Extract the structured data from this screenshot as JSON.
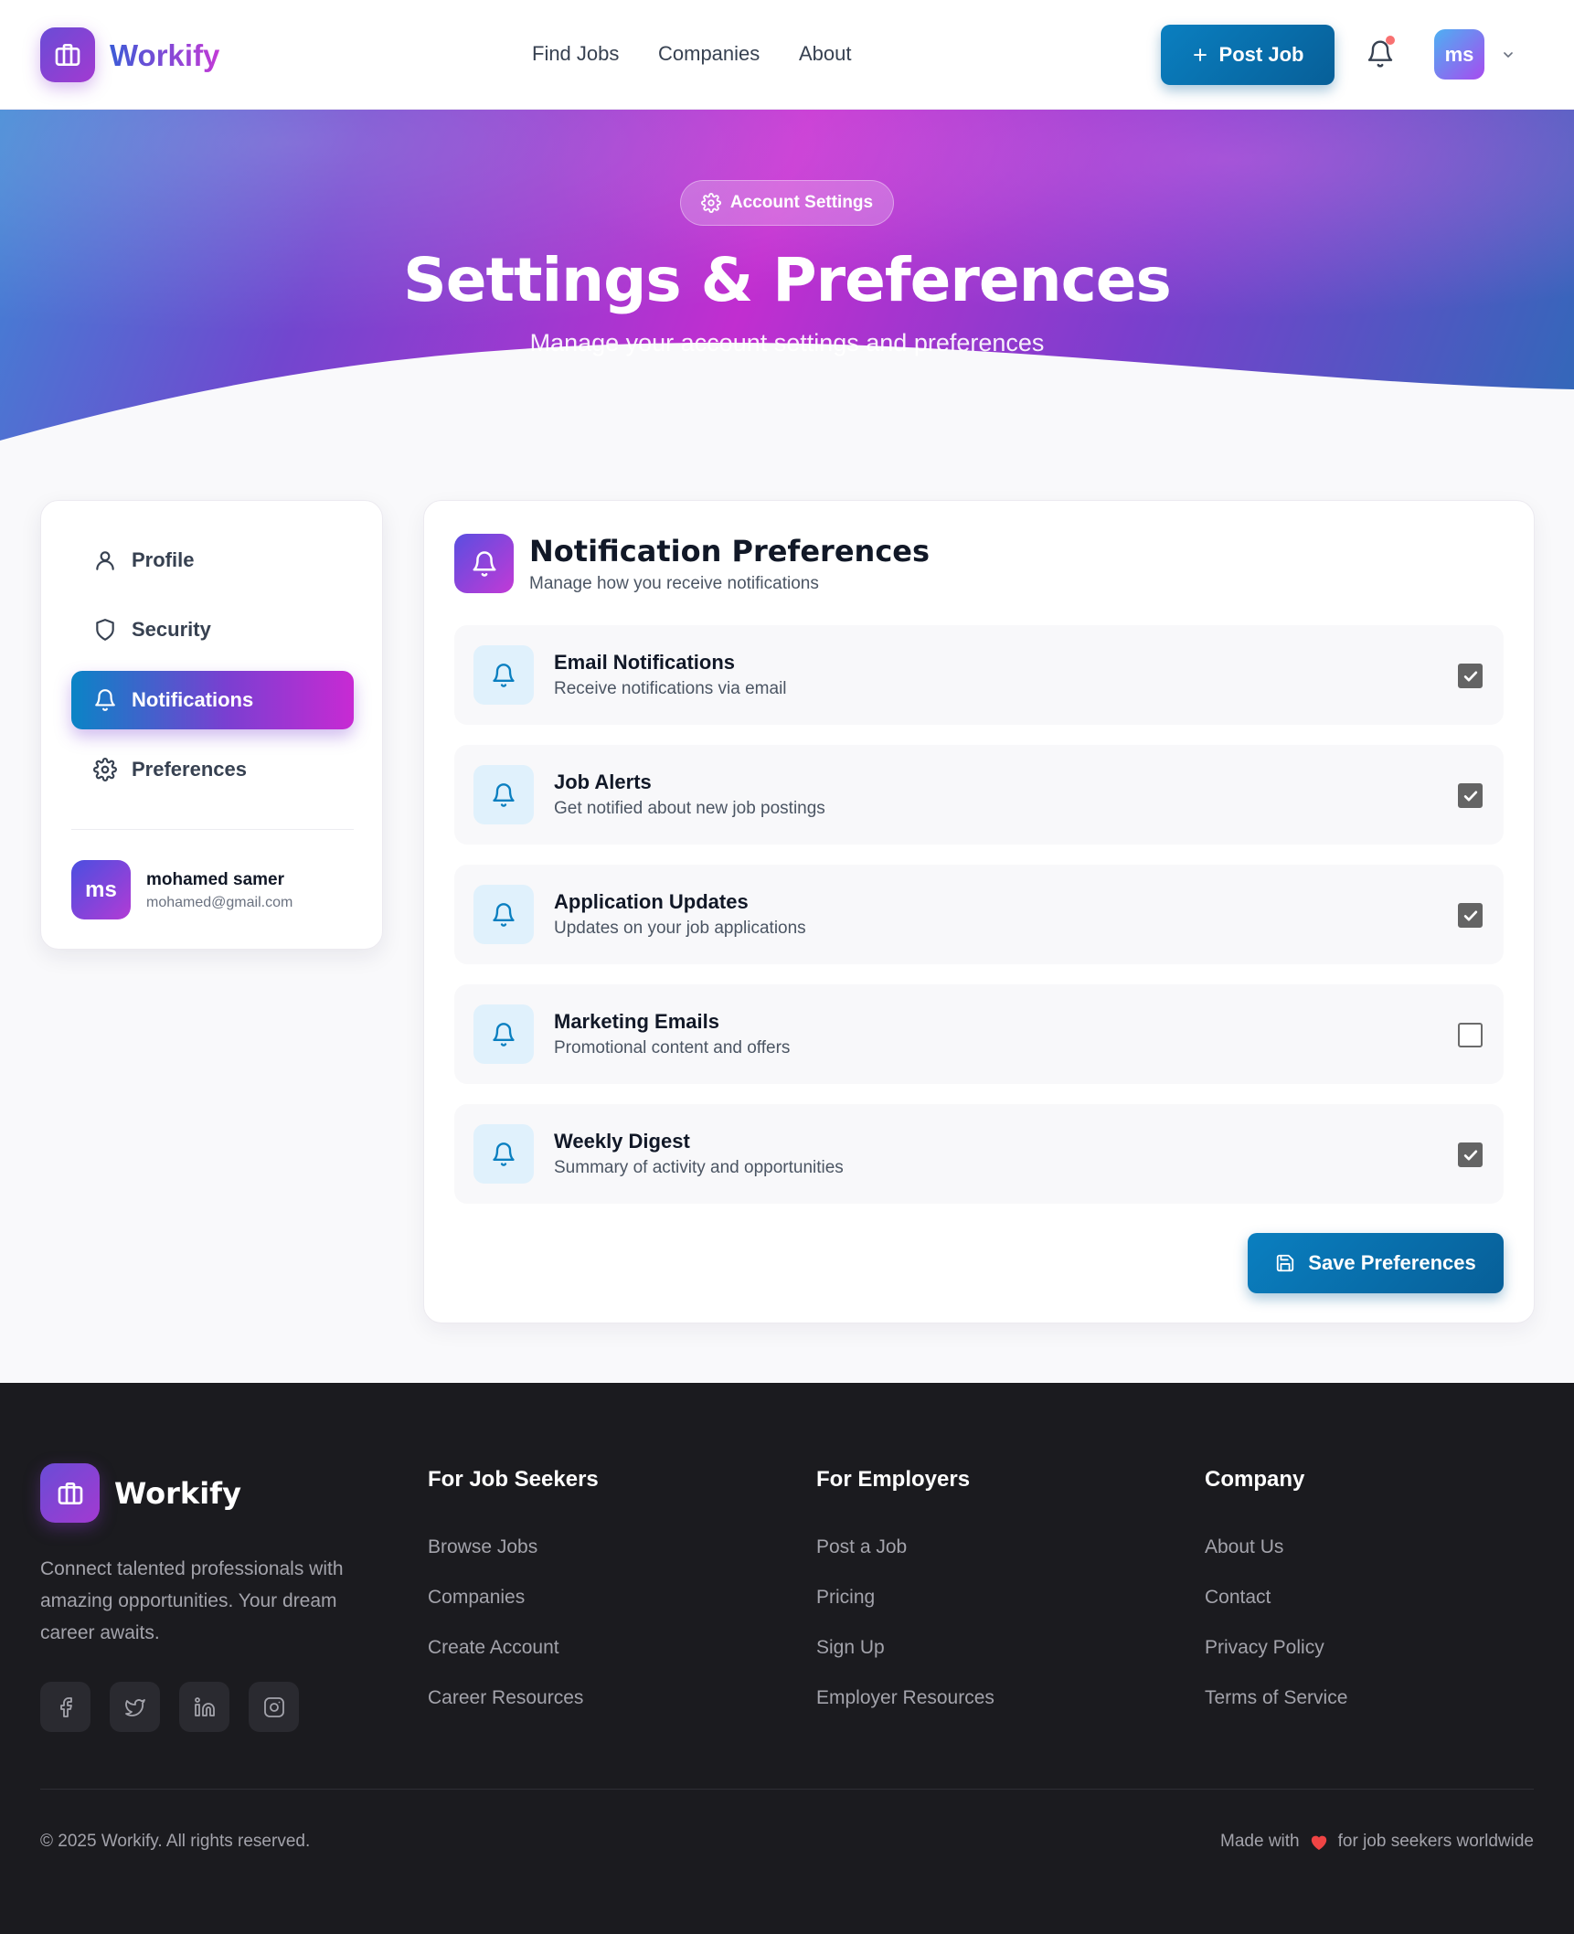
{
  "header": {
    "brand": "Workify",
    "nav": [
      "Find Jobs",
      "Companies",
      "About"
    ],
    "post_job_label": "Post Job",
    "avatar_initials": "ms"
  },
  "hero": {
    "pill_label": "Account Settings",
    "title": "Settings & Preferences",
    "subtitle": "Manage your account settings and preferences"
  },
  "sidebar": {
    "items": [
      {
        "label": "Profile",
        "icon": "user-icon"
      },
      {
        "label": "Security",
        "icon": "shield-icon"
      },
      {
        "label": "Notifications",
        "icon": "bell-icon",
        "active": true
      },
      {
        "label": "Preferences",
        "icon": "gear-icon"
      }
    ],
    "user": {
      "initials": "ms",
      "name": "mohamed samer",
      "email": "mohamed@gmail.com"
    }
  },
  "notifications": {
    "title": "Notification Preferences",
    "subtitle": "Manage how you receive notifications",
    "items": [
      {
        "title": "Email Notifications",
        "desc": "Receive notifications via email",
        "checked": true
      },
      {
        "title": "Job Alerts",
        "desc": "Get notified about new job postings",
        "checked": true
      },
      {
        "title": "Application Updates",
        "desc": "Updates on your job applications",
        "checked": true
      },
      {
        "title": "Marketing Emails",
        "desc": "Promotional content and offers",
        "checked": false
      },
      {
        "title": "Weekly Digest",
        "desc": "Summary of activity and opportunities",
        "checked": true
      }
    ],
    "save_label": "Save Preferences"
  },
  "footer": {
    "brand": "Workify",
    "tagline": "Connect talented professionals with amazing opportunities. Your dream career awaits.",
    "columns": [
      {
        "heading": "For Job Seekers",
        "links": [
          "Browse Jobs",
          "Companies",
          "Create Account",
          "Career Resources"
        ]
      },
      {
        "heading": "For Employers",
        "links": [
          "Post a Job",
          "Pricing",
          "Sign Up",
          "Employer Resources"
        ]
      },
      {
        "heading": "Company",
        "links": [
          "About Us",
          "Contact",
          "Privacy Policy",
          "Terms of Service"
        ]
      }
    ],
    "social": [
      "facebook-icon",
      "twitter-icon",
      "linkedin-icon",
      "instagram-icon"
    ],
    "copyright": "© 2025 Workify. All rights reserved.",
    "made_with_prefix": "Made with",
    "made_with_suffix": "for job seekers worldwide"
  },
  "colors": {
    "brand_gradient_start": "#0a84c6",
    "brand_gradient_end": "#c82ad3",
    "primary_button": "#0a7fc0",
    "footer_bg": "#1b1b1f",
    "notification_dot": "#f87171",
    "heart": "#ef4444"
  }
}
